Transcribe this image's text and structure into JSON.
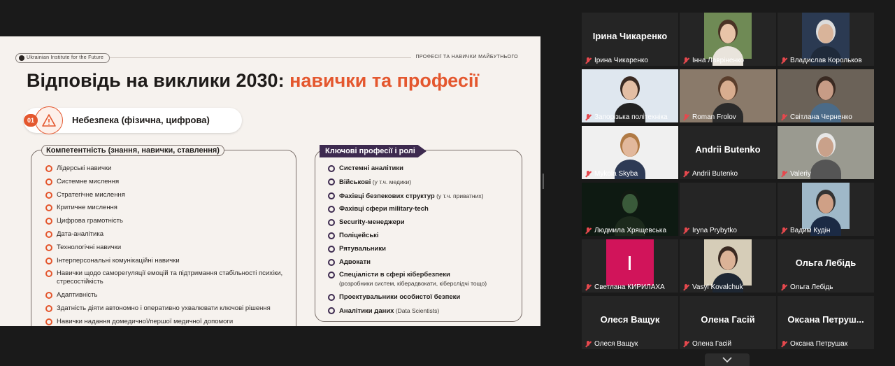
{
  "slide": {
    "brand": "Ukrainian Institute for the Future",
    "tag": "ПРОФЕСІЇ ТА НАВИЧКИ МАЙБУТНЬОГО",
    "title_main": "Відповідь на виклики 2030: ",
    "title_accent": "навички та професії",
    "risk_number": "01",
    "risk_label": "Небезпека (фізична, цифрова)",
    "competence_title": "Компетентність (знання, навички, ставлення)",
    "competences": [
      "Лідерські навички",
      "Системне мислення",
      "Стратегічне мислення",
      "Критичне мислення",
      "Цифрова грамотність",
      "Дата-аналітика",
      "Технологічні навички",
      "Інтерперсональні комунікаційні навички",
      "Навички щодо саморегуляції емоцій та підтримання стабільності психіки, стресостійкість",
      "Адаптивність",
      "Здатність діяти автономно і оперативно ухвалювати ключові рішення",
      "Навички надання домедичної/першої медичної допомоги"
    ],
    "professions_title": "Ключові професії і ролі",
    "professions": [
      {
        "label": "Системні аналітики",
        "note": ""
      },
      {
        "label": "Військові",
        "note": " (у т.ч. медики)"
      },
      {
        "label": "Фахівці безпекових структур",
        "note": " (у т.ч. приватних)"
      },
      {
        "label": "Фахівці сфери military-tech",
        "note": ""
      },
      {
        "label": "Security-менеджери",
        "note": ""
      },
      {
        "label": "Поліцейські",
        "note": ""
      },
      {
        "label": "Рятувальники",
        "note": ""
      },
      {
        "label": "Адвокати",
        "note": ""
      },
      {
        "label": "Спеціалісти в сфері кібербезпеки",
        "note": "(розробники систем, кіберадвокати, кіберслідчі тощо)"
      },
      {
        "label": "Проектувальники особистої безпеки",
        "note": ""
      },
      {
        "label": "Аналітики даних",
        "note": " (Data Scientists)"
      }
    ]
  },
  "participants": [
    {
      "name": "Ірина Чикаренко",
      "display": "Ірина Чикаренко",
      "video": false
    },
    {
      "name": "Інна Лавріненко",
      "display": "",
      "video": true
    },
    {
      "name": "Владислав Корольков",
      "display": "",
      "video": true
    },
    {
      "name": "Запорізька політехніка",
      "display": "",
      "video": true
    },
    {
      "name": "Roman Frolov",
      "display": "",
      "video": true
    },
    {
      "name": "Світлана Черненко",
      "display": "",
      "video": true
    },
    {
      "name": "Mykola Skyba",
      "display": "",
      "video": true,
      "active": true
    },
    {
      "name": "Andrii Butenko",
      "display": "Andrii Butenko",
      "video": false
    },
    {
      "name": "Valeriy",
      "display": "",
      "video": true
    },
    {
      "name": "Людмила Хрящевська",
      "display": "",
      "video": true
    },
    {
      "name": "Iryna Prybytko",
      "display": "",
      "video": false
    },
    {
      "name": "Вадим Кудін",
      "display": "",
      "video": true
    },
    {
      "name": "Светлана КИРИЛАХА",
      "display": "",
      "video": true
    },
    {
      "name": "Vasyl Kovalchuk",
      "display": "",
      "video": true
    },
    {
      "name": "Ольга Лебідь",
      "display": "Ольга Лебідь",
      "video": false
    },
    {
      "name": "Олеся Ващук",
      "display": "Олеся Ващук",
      "video": false
    },
    {
      "name": "Олена Гасій",
      "display": "Олена Гасій",
      "video": false
    },
    {
      "name": "Оксана Петрушак",
      "display": "Оксана  Петруш...",
      "video": false
    }
  ],
  "colors": {
    "accent": "#e4572e",
    "dark_purple": "#3d2a4f",
    "active_speaker": "#c9e35a",
    "muted": "#e5484d"
  },
  "icons": {
    "risk": "warning-icon",
    "muted": "mic-off-icon",
    "expand": "chevron-down-icon"
  }
}
